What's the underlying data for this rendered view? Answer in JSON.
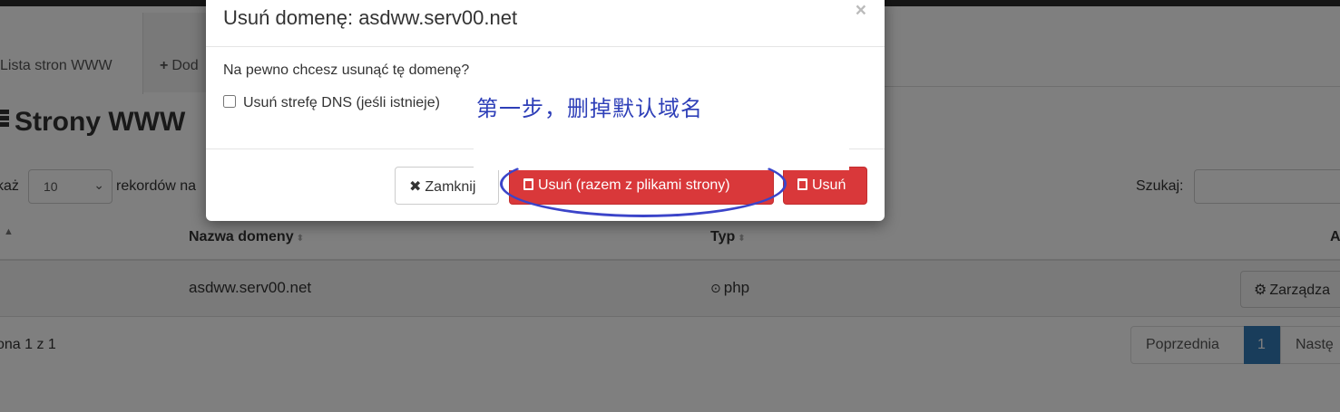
{
  "tabs": {
    "list_label": "Lista stron WWW",
    "add_label": "Dod"
  },
  "page": {
    "title": "Strony WWW"
  },
  "length_control": {
    "prefix": "każ",
    "selected": "10",
    "suffix": "rekordów na"
  },
  "search": {
    "label": "Szukaj:"
  },
  "table": {
    "headers": [
      "Nazwa domeny",
      "Typ",
      "A"
    ],
    "rows": [
      {
        "domain": "asdww.serv00.net",
        "type": "php",
        "action": "Zarządza"
      }
    ]
  },
  "pagination": {
    "info": "ona 1 z 1",
    "prev": "Poprzednia",
    "current": "1",
    "next": "Nastę"
  },
  "modal": {
    "title": "Usuń domenę: asdww.serv00.net",
    "question": "Na pewno chcesz usunąć tę domenę?",
    "dns_checkbox_label": "Usuń strefę DNS (jeśli istnieje)",
    "annotation": "第一步，删掉默认域名",
    "close_label": "Zamknij",
    "delete_with_files_label": "Usuń (razem z plikami strony)",
    "delete_label": "Usuń"
  },
  "colors": {
    "danger": "#d9383a",
    "annotation": "#2e3fb8",
    "active_page": "#337ab7"
  }
}
